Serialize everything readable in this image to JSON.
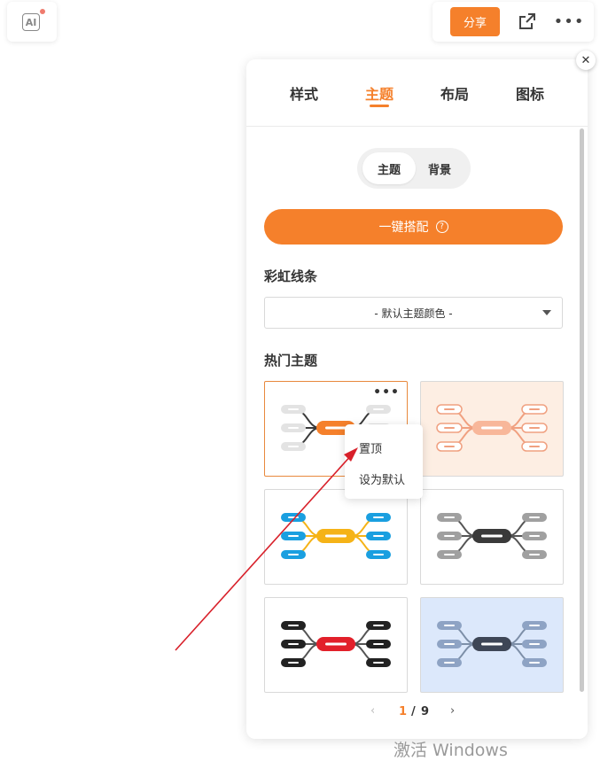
{
  "toolbar": {
    "ai_label": "AI",
    "share_label": "分享"
  },
  "panel": {
    "tabs": [
      {
        "label": "样式"
      },
      {
        "label": "主题"
      },
      {
        "label": "布局"
      },
      {
        "label": "图标"
      }
    ],
    "active_tab": "主题",
    "segment": {
      "options": [
        "主题",
        "背景"
      ],
      "selected": "主题"
    },
    "match_button": "一键搭配",
    "rainbow_title": "彩虹线条",
    "rainbow_select": "- 默认主题颜色 -",
    "hot_title": "热门主题",
    "context_menu": [
      "置顶",
      "设为默认"
    ],
    "pager": {
      "current": "1",
      "separator": "/",
      "total": "9"
    }
  },
  "themes": [
    {
      "center": "#f5802b",
      "branch_line": "#3a3a3a",
      "leaf": "#e3e3e3",
      "bg": "#ffffff",
      "selected": true
    },
    {
      "center": "#f8b79a",
      "branch_line": "#f0a080",
      "leaf": "#ffffff",
      "leaf_border": "#f0a080",
      "bg": "#fdeee3"
    },
    {
      "center": "#f5b317",
      "branch_line": "#f5b317",
      "leaf": "#1a9fe0",
      "bg": "#ffffff"
    },
    {
      "center": "#3a3a3a",
      "branch_line": "#555555",
      "leaf": "#a0a0a0",
      "bg": "#ffffff"
    },
    {
      "center": "#e2202a",
      "branch_line": "#555555",
      "leaf": "#222222",
      "bg": "#ffffff"
    },
    {
      "center": "#3e4656",
      "branch_line": "#7d8fa8",
      "leaf": "#8ea3c4",
      "bg": "#dce8fb"
    }
  ],
  "watermark": "激活 Windows"
}
